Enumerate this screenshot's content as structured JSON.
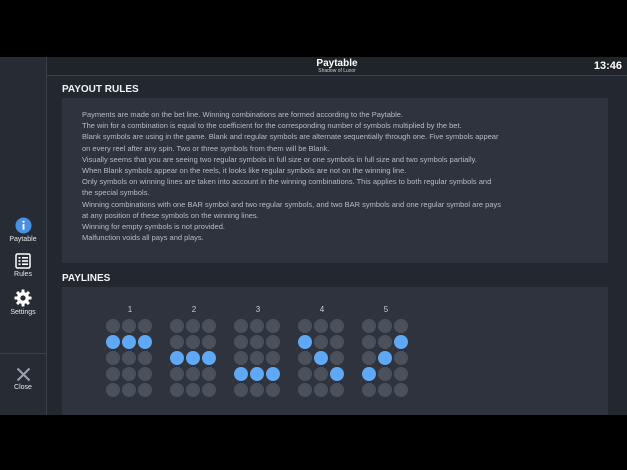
{
  "header": {
    "title": "Paytable",
    "subtitle": "Shadow of Luxor",
    "clock": "13:46"
  },
  "sidebar": {
    "items": [
      {
        "label": "Paytable",
        "icon": "info-icon"
      },
      {
        "label": "Rules",
        "icon": "list-icon"
      },
      {
        "label": "Settings",
        "icon": "gear-icon"
      },
      {
        "label": "Close",
        "icon": "close-icon"
      }
    ]
  },
  "payout_rules": {
    "title": "PAYOUT RULES",
    "lines": [
      "Payments are made on the bet line. Winning combinations are formed according to the Paytable.",
      "The win for a combination is equal to the coefficient for the corresponding number of symbols multiplied by the bet.",
      "Blank symbols are using in the game. Blank and regular symbols are alternate sequentially through one. Five symbols appear",
      "on every reel after any spin. Two or three symbols from them will be Blank.",
      "Visually seems that you are seeing two regular symbols in full size or one symbols in full size and two symbols partially.",
      "When Blank symbols appear on the reels, it looks like regular symbols are not on the winning line.",
      "Only symbols on winning lines are taken into account in the winning combinations. This applies to both regular symbols and",
      "the special symbols.",
      "Winning combinations with one BAR symbol and two regular symbols, and two BAR symbols and one regular symbol are pays",
      "at any position of these symbols on the winning lines.",
      "Winning for empty symbols is not provided.",
      "Malfunction voids all pays and plays."
    ]
  },
  "paylines": {
    "title": "PAYLINES",
    "lines": [
      {
        "number": "1",
        "rows": [
          1,
          1,
          1
        ]
      },
      {
        "number": "2",
        "rows": [
          2,
          2,
          2
        ]
      },
      {
        "number": "3",
        "rows": [
          3,
          3,
          3
        ]
      },
      {
        "number": "4",
        "rows": [
          1,
          2,
          3
        ]
      },
      {
        "number": "5",
        "rows": [
          3,
          2,
          1
        ]
      }
    ],
    "grid_rows": 5,
    "grid_cols": 3
  },
  "colors": {
    "active_dot": "#5fa8f5",
    "inactive_dot": "#4b515c",
    "accent_icon": "#4a90e2"
  }
}
